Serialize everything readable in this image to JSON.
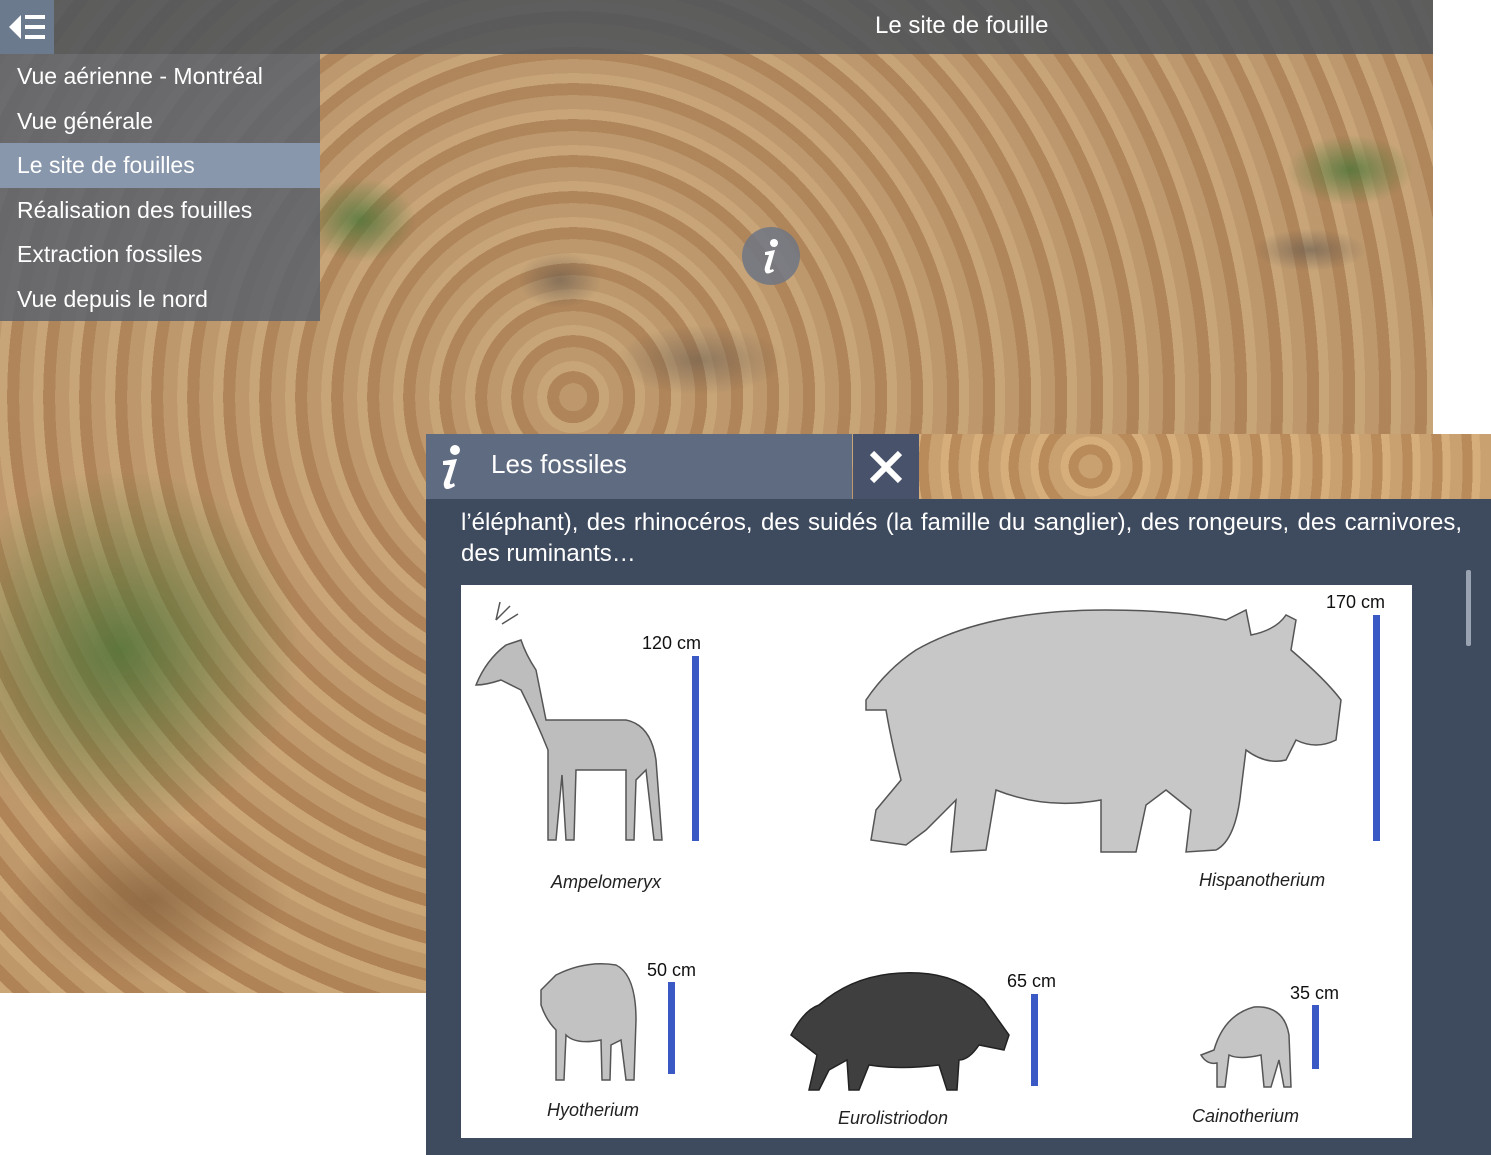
{
  "header": {
    "title": "Le site de fouille"
  },
  "menu": {
    "items": [
      {
        "label": "Vue aérienne - Montréal"
      },
      {
        "label": "Vue générale"
      },
      {
        "label": "Le site de fouilles",
        "active": true
      },
      {
        "label": "Réalisation des fouilles"
      },
      {
        "label": "Extraction fossiles"
      },
      {
        "label": "Vue depuis le nord"
      }
    ]
  },
  "hotspot": {
    "icon": "info-icon"
  },
  "panel": {
    "title": "Les fossiles",
    "text": "l’éléphant), des rhinocéros, des suidés (la famille du sanglier), des rongeurs, des carnivores, des ruminants…",
    "figure": {
      "animals": [
        {
          "name": "Ampelomeryx",
          "height": "120 cm"
        },
        {
          "name": "Hispanotherium",
          "height": "170 cm"
        },
        {
          "name": "Hyotherium",
          "height": "50 cm"
        },
        {
          "name": "Eurolistriodon",
          "height": "65 cm"
        },
        {
          "name": "Cainotherium",
          "height": "35 cm"
        }
      ]
    }
  },
  "colors": {
    "menu_active": "#8c9cb2",
    "panel_header": "#5e6b80",
    "panel_body": "#3e4a5e",
    "height_bar": "#3a59c4"
  }
}
